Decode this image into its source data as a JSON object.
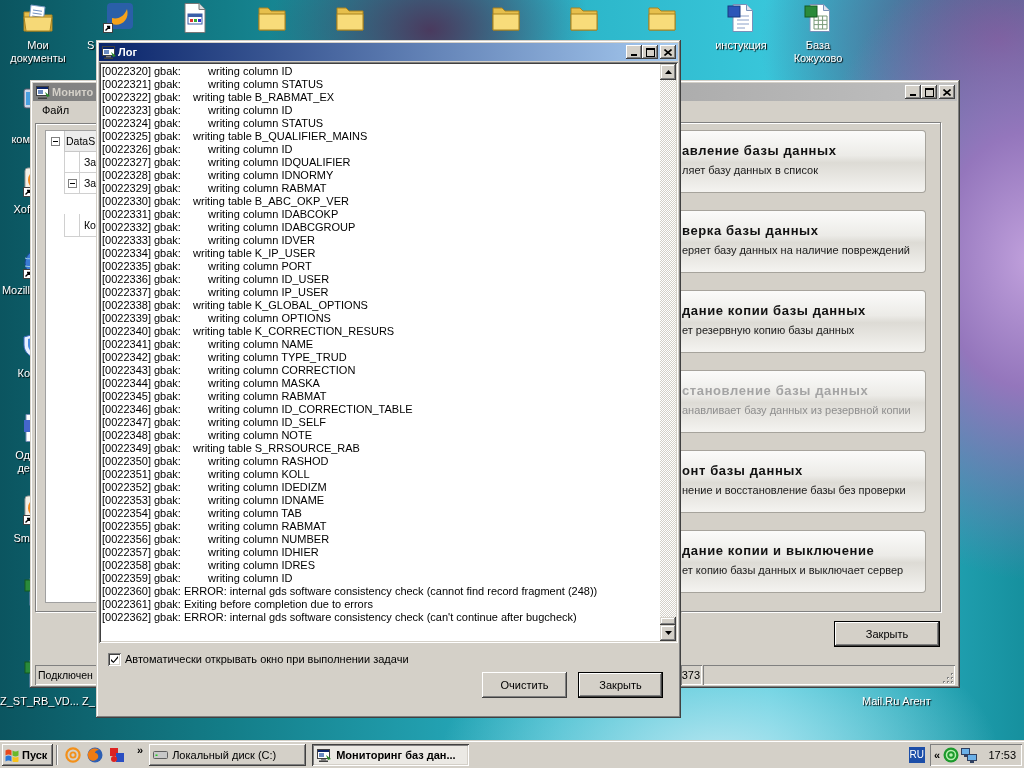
{
  "desktop": {
    "icons": [
      {
        "kind": "documents",
        "label": "Мои документы"
      },
      {
        "kind": "shortcut",
        "label": "S"
      },
      {
        "kind": "page"
      },
      {
        "kind": "folder"
      },
      {
        "kind": "folder"
      },
      {
        "kind": "folder"
      },
      {
        "kind": "folder"
      },
      {
        "kind": "folder"
      },
      {
        "kind": "word",
        "label": "инстукция"
      },
      {
        "kind": "excel",
        "label": "База Кожухово"
      }
    ],
    "side_icons": [
      {
        "kind": "computer",
        "label": "ком"
      },
      {
        "kind": "app",
        "label": "Xof"
      },
      {
        "kind": "globe",
        "label": "Mozill"
      },
      {
        "kind": "shield",
        "label": "Ко"
      },
      {
        "kind": "doc",
        "label": "Од де"
      },
      {
        "kind": "app",
        "label": "Sm"
      },
      {
        "kind": "excel"
      },
      {
        "kind": "excel",
        "label": "Z_ST_RB_VD..."
      }
    ],
    "other_labels": [
      "Z_",
      "Mail.Ru Агент"
    ]
  },
  "monitor_window": {
    "title": "Монито",
    "active": false,
    "menu": [
      "Файл"
    ],
    "tree": [
      {
        "label": "DataS",
        "expanded": true,
        "children": [
          {
            "label": "За"
          },
          {
            "label": "За",
            "expanded": true,
            "children": [
              {
                "label": "Ко"
              }
            ]
          }
        ]
      }
    ],
    "actions": [
      {
        "title": "авление базы данных",
        "description": "ляет базу данных в список",
        "disabled": false
      },
      {
        "title": "верка базы данных",
        "description": "еряет базу данных на наличие повреждений",
        "disabled": false
      },
      {
        "title": "дание копии базы данных",
        "description": "ет резервную копию базы данных",
        "disabled": false
      },
      {
        "title": "становление базы данных",
        "description": "анавливает базу данных из резервной копии",
        "disabled": true
      },
      {
        "title": "онт базы данных",
        "description": "нение и восстановление базы без проверки",
        "disabled": false
      },
      {
        "title": "дание копии и выключение",
        "description": "ет копию базы данных и выключает сервер",
        "disabled": false
      }
    ],
    "close_button": {
      "label": "Закрыть",
      "default": true
    },
    "status_bar": [
      "Подключен",
      "373"
    ]
  },
  "log_window": {
    "title": "Лог",
    "active": true,
    "lines": [
      {
        "source": "[0022320] gbak:",
        "kind": "column",
        "message": "writing column ID"
      },
      {
        "source": "[0022321] gbak:",
        "kind": "column",
        "message": "writing column STATUS"
      },
      {
        "source": "[0022322] gbak:",
        "kind": "table",
        "message": "writing table B_RABMAT_EX"
      },
      {
        "source": "[0022323] gbak:",
        "kind": "column",
        "message": "writing column ID"
      },
      {
        "source": "[0022324] gbak:",
        "kind": "column",
        "message": "writing column STATUS"
      },
      {
        "source": "[0022325] gbak:",
        "kind": "table",
        "message": "writing table B_QUALIFIER_MAINS"
      },
      {
        "source": "[0022326] gbak:",
        "kind": "column",
        "message": "writing column ID"
      },
      {
        "source": "[0022327] gbak:",
        "kind": "column",
        "message": "writing column IDQUALIFIER"
      },
      {
        "source": "[0022328] gbak:",
        "kind": "column",
        "message": "writing column IDNORMY"
      },
      {
        "source": "[0022329] gbak:",
        "kind": "column",
        "message": "writing column RABMAT"
      },
      {
        "source": "[0022330] gbak:",
        "kind": "table",
        "message": "writing table B_ABC_OKP_VER"
      },
      {
        "source": "[0022331] gbak:",
        "kind": "column",
        "message": "writing column IDABCOKP"
      },
      {
        "source": "[0022332] gbak:",
        "kind": "column",
        "message": "writing column IDABCGROUP"
      },
      {
        "source": "[0022333] gbak:",
        "kind": "column",
        "message": "writing column IDVER"
      },
      {
        "source": "[0022334] gbak:",
        "kind": "table",
        "message": "writing table K_IP_USER"
      },
      {
        "source": "[0022335] gbak:",
        "kind": "column",
        "message": "writing column PORT"
      },
      {
        "source": "[0022336] gbak:",
        "kind": "column",
        "message": "writing column ID_USER"
      },
      {
        "source": "[0022337] gbak:",
        "kind": "column",
        "message": "writing column IP_USER"
      },
      {
        "source": "[0022338] gbak:",
        "kind": "table",
        "message": "writing table K_GLOBAL_OPTIONS"
      },
      {
        "source": "[0022339] gbak:",
        "kind": "column",
        "message": "writing column OPTIONS"
      },
      {
        "source": "[0022340] gbak:",
        "kind": "table",
        "message": "writing table K_CORRECTION_RESURS"
      },
      {
        "source": "[0022341] gbak:",
        "kind": "column",
        "message": "writing column NAME"
      },
      {
        "source": "[0022342] gbak:",
        "kind": "column",
        "message": "writing column TYPE_TRUD"
      },
      {
        "source": "[0022343] gbak:",
        "kind": "column",
        "message": "writing column CORRECTION"
      },
      {
        "source": "[0022344] gbak:",
        "kind": "column",
        "message": "writing column MASKA"
      },
      {
        "source": "[0022345] gbak:",
        "kind": "column",
        "message": "writing column RABMAT"
      },
      {
        "source": "[0022346] gbak:",
        "kind": "column",
        "message": "writing column ID_CORRECTION_TABLE"
      },
      {
        "source": "[0022347] gbak:",
        "kind": "column",
        "message": "writing column ID_SELF"
      },
      {
        "source": "[0022348] gbak:",
        "kind": "column",
        "message": "writing column NOTE"
      },
      {
        "source": "[0022349] gbak:",
        "kind": "table",
        "message": "writing table S_RRSOURCE_RAB"
      },
      {
        "source": "[0022350] gbak:",
        "kind": "column",
        "message": "writing column RASHOD"
      },
      {
        "source": "[0022351] gbak:",
        "kind": "column",
        "message": "writing column KOLL"
      },
      {
        "source": "[0022352] gbak:",
        "kind": "column",
        "message": "writing column IDEDIZM"
      },
      {
        "source": "[0022353] gbak:",
        "kind": "column",
        "message": "writing column IDNAME"
      },
      {
        "source": "[0022354] gbak:",
        "kind": "column",
        "message": "writing column TAB"
      },
      {
        "source": "[0022355] gbak:",
        "kind": "column",
        "message": "writing column RABMAT"
      },
      {
        "source": "[0022356] gbak:",
        "kind": "column",
        "message": "writing column NUMBER"
      },
      {
        "source": "[0022357] gbak:",
        "kind": "column",
        "message": "writing column IDHIER"
      },
      {
        "source": "[0022358] gbak:",
        "kind": "column",
        "message": "writing column IDRES"
      },
      {
        "source": "[0022359] gbak:",
        "kind": "column",
        "message": "writing column ID"
      },
      {
        "source": "[0022360] gbak:",
        "kind": "message",
        "message": "ERROR: internal gds software consistency check (cannot find record fragment (248))"
      },
      {
        "source": "[0022361] gbak:",
        "kind": "message",
        "message": "Exiting before completion due to errors"
      },
      {
        "source": "[0022362] gbak:",
        "kind": "message",
        "message": "ERROR: internal gds software consistency check (can't continue after bugcheck)"
      }
    ],
    "auto_open": {
      "label": "Автоматически открывать окно при выполнении задачи",
      "checked": true
    },
    "buttons": [
      {
        "label": "Очистить",
        "default": false
      },
      {
        "label": "Закрыть",
        "default": true
      }
    ]
  },
  "taskbar": {
    "start": "Пуск",
    "quick_launch": [
      {
        "kind": "mail"
      },
      {
        "kind": "browser"
      },
      {
        "kind": "app"
      }
    ],
    "more": "»",
    "tasks": [
      {
        "kind": "drive",
        "label": "Локальный диск (C:)",
        "selected": false
      },
      {
        "kind": "monitor",
        "label": "Мониторинг баз дан...",
        "selected": true
      }
    ],
    "language": "RU",
    "tray": {
      "more": "«",
      "icons": [
        {
          "kind": "status"
        },
        {
          "kind": "network"
        }
      ],
      "clock": "17:53"
    }
  }
}
